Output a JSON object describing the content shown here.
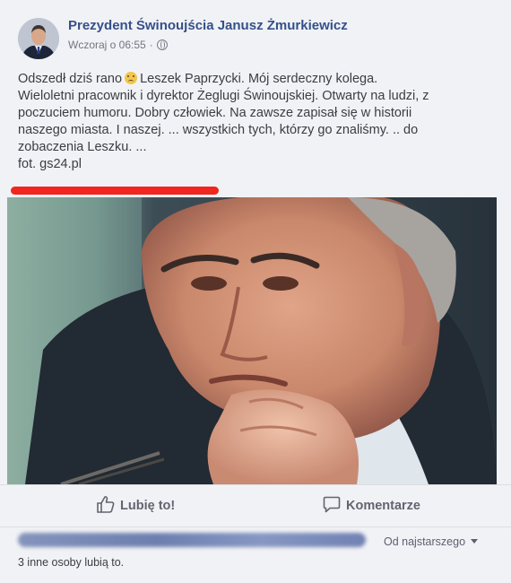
{
  "post": {
    "author": "Prezydent Świnoujścia Janusz Żmurkiewicz",
    "timestamp": "Wczoraj o 06:55",
    "separator": "·",
    "privacy_icon": "globe-icon",
    "body_lines": [
      "Odszedł dziś rano",
      "Leszek Paprzycki. Mój serdeczny kolega.",
      "Wieloletni pracownik i dyrektor Żeglugi Świnoujskiej. Otwarty na ludzi, z",
      "poczuciem humoru. Dobry człowiek. Na zawsze zapisał się w historii",
      "naszego miasta. I naszej. ... wszystkich tych, którzy go znaliśmy. .. do",
      "zobaczenia Leszku. ...",
      "fot. gs24.pl"
    ],
    "emoji": "sad-face-emoji"
  },
  "actions": {
    "like_label": "Lubię to!",
    "comment_label": "Komentarze"
  },
  "reactions": {
    "sort_label": "Od najstarszego",
    "likes_text": "3 inne osoby lubią to."
  },
  "colors": {
    "author": "#35508a",
    "annotation_red": "#f0261f",
    "background": "#f1f2f5"
  }
}
